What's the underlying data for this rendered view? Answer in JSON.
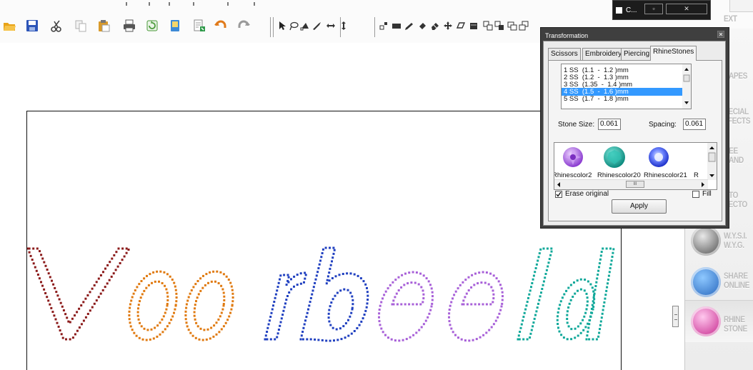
{
  "toolbar": {
    "items": [
      {
        "name": "open-folder-icon",
        "color": "#e8a317"
      },
      {
        "name": "save-icon",
        "color": "#2d55b8"
      },
      {
        "name": "cut-icon",
        "color": "#444444"
      },
      {
        "name": "copy-icon",
        "color": "#b0b0b0"
      },
      {
        "name": "paste-icon",
        "color": "#d99a2b"
      },
      {
        "name": "print-icon",
        "color": "#555555"
      },
      {
        "name": "refresh-icon",
        "color": "#4a9a3a"
      },
      {
        "name": "book-icon",
        "color": "#3d8ad6"
      },
      {
        "name": "export-icon",
        "color": "#2f9a4a"
      },
      {
        "name": "undo-icon",
        "color": "#e07a1a"
      },
      {
        "name": "redo-icon",
        "color": "#9a9a9a"
      }
    ],
    "tools": [
      "select-arrow-icon",
      "lasso-icon",
      "node-edit-icon",
      "knife-icon",
      "flip-horizontal-icon",
      "flip-vertical-icon",
      "align-icon",
      "rectangle-icon",
      "pencil-icon",
      "fill-icon",
      "eraser-icon",
      "move-icon",
      "shape-icon",
      "layer-icon",
      "group-icon",
      "ungroup-icon",
      "weld-icon",
      "trim-icon"
    ]
  },
  "taskbar": {
    "label": "C...",
    "min_label": "▫",
    "close_label": "✕"
  },
  "dialog": {
    "title": "Transformation",
    "tabs": [
      {
        "label": "Scissors"
      },
      {
        "label": "Embroidery"
      },
      {
        "label": "Piercing"
      },
      {
        "label": "RhineStones"
      }
    ],
    "size_list": {
      "items": [
        "1 SS  (1.1  -  1.2 )mm",
        "2 SS  (1.2  -  1.3 )mm",
        "3 SS  (1.35  -  1.4 )mm",
        "4 SS  (1.5  -  1.6 )mm",
        "5 SS  (1.7  -  1.8 )mm"
      ],
      "selected": "4 SS  (1.5  -  1.6 )mm"
    },
    "stone_size": {
      "label": "Stone Size:",
      "value": "0.061"
    },
    "spacing": {
      "label": "Spacing:",
      "value": "0.061"
    },
    "stones": [
      {
        "label": "Rhinescolor2",
        "color": "#a64fe0"
      },
      {
        "label": "Rhinescolor20",
        "color": "#16a89a"
      },
      {
        "label": "Rhinescolor21",
        "color": "#2b3fd8"
      },
      {
        "label": "R"
      }
    ],
    "erase_original": {
      "label": "Erase original",
      "checked": true
    },
    "fill": {
      "label": "Fill",
      "checked": false
    },
    "apply_label": "Apply",
    "close_icon": "close-icon"
  },
  "sidepanel": {
    "items": [
      {
        "label": "EXT",
        "icon": "text-icon"
      },
      {
        "label": "HAPES",
        "icon": "shapes-icon"
      },
      {
        "label": "PECIAL\nFFECTS",
        "icon": "special-effects-icon"
      },
      {
        "label": "REE\nHAND",
        "icon": "freehand-icon"
      },
      {
        "label": "UTO\nVECTO",
        "icon": "auto-vector-icon"
      },
      {
        "label": "W.Y.S.I.\nW.Y.G.",
        "icon": "wysiwyg-scissors-icon"
      },
      {
        "label": "SHARE\nONLINE",
        "icon": "share-online-icon"
      },
      {
        "label": "RHINE\nSTONE",
        "icon": "rhinestone-icon"
      }
    ]
  },
  "artwork": {
    "text": "Voorbeeld",
    "colors": {
      "V": "#8b1a1a",
      "o": "#e07a10",
      "rb": "#2040c0",
      "ee": "#a860d8",
      "ld": "#10a89a"
    }
  }
}
